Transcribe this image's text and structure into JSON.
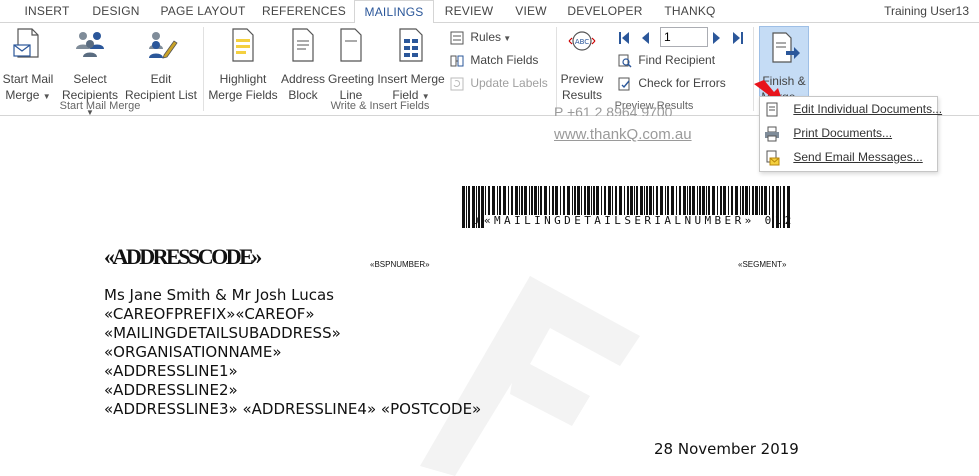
{
  "tabs": [
    "INSERT",
    "DESIGN",
    "PAGE LAYOUT",
    "REFERENCES",
    "MAILINGS",
    "REVIEW",
    "VIEW",
    "DEVELOPER",
    "THANKQ"
  ],
  "user": "Training User13",
  "ribbon": {
    "start_mail_merge": {
      "line1": "Start Mail",
      "line2": "Merge"
    },
    "select_recipients": {
      "line1": "Select",
      "line2": "Recipients"
    },
    "edit_recipient_list": {
      "line1": "Edit",
      "line2": "Recipient List"
    },
    "group_start": "Start Mail Merge",
    "highlight_merge_fields": {
      "line1": "Highlight",
      "line2": "Merge Fields"
    },
    "address_block": {
      "line1": "Address",
      "line2": "Block"
    },
    "greeting_line": {
      "line1": "Greeting",
      "line2": "Line"
    },
    "insert_merge_field": {
      "line1": "Insert Merge",
      "line2": "Field"
    },
    "rules": "Rules",
    "match_fields": "Match Fields",
    "update_labels": "Update Labels",
    "group_write": "Write & Insert Fields",
    "preview_results": {
      "line1": "Preview",
      "line2": "Results"
    },
    "record_number": "1",
    "find_recipient": "Find Recipient",
    "check_for_errors": "Check for Errors",
    "group_preview": "Preview Results",
    "finish_merge": {
      "line1": "Finish &",
      "line2": "Merge"
    }
  },
  "dropdown": {
    "items": [
      "Edit Individual Documents...",
      "Print Documents...",
      "Send Email Messages..."
    ]
  },
  "document": {
    "header_phone": "P +61 2 8964 9700",
    "header_url": "www.thankQ.com.au",
    "barcode_text": "«MAILINGDETAILSERIALNUMBER» 012",
    "barcode_prefix": "U",
    "addresscode": "«ADDRESSCODE»",
    "bspnumber": "«BSPNUMBER»",
    "segment": "«SEGMENT»",
    "address_lines": [
      "Ms Jane Smith & Mr Josh Lucas",
      "«CAREOFPREFIX»«CAREOF»",
      "«MAILINGDETAILSUBADDRESS»",
      "«ORGANISATIONNAME»",
      "«ADDRESSLINE1»",
      "«ADDRESSLINE2»",
      "«ADDRESSLINE3» «ADDRESSLINE4» «POSTCODE»"
    ],
    "date": "28 November 2019"
  },
  "colors": {
    "accent": "#2b579a",
    "highlight": "#c5dcf5",
    "arrow": "#e8141c"
  }
}
